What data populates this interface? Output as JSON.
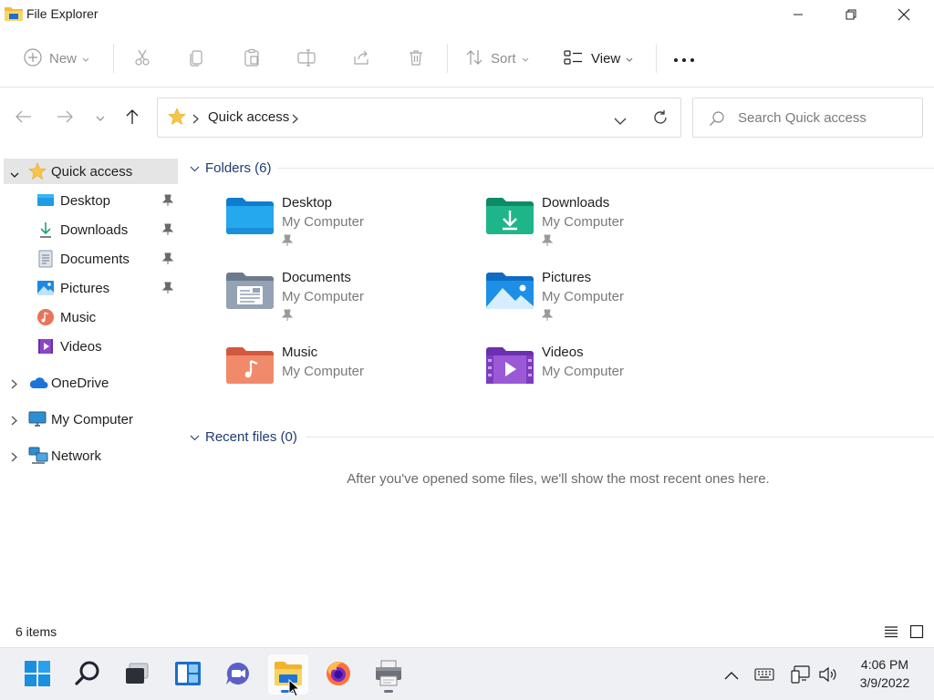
{
  "window": {
    "title": "File Explorer"
  },
  "toolbar": {
    "new_label": "New",
    "sort_label": "Sort",
    "view_label": "View"
  },
  "address": {
    "crumb": "Quick access"
  },
  "search": {
    "placeholder": "Search Quick access"
  },
  "sidebar": {
    "quick_access": "Quick access",
    "items": [
      {
        "label": "Desktop",
        "pinned": true
      },
      {
        "label": "Downloads",
        "pinned": true
      },
      {
        "label": "Documents",
        "pinned": true
      },
      {
        "label": "Pictures",
        "pinned": true
      },
      {
        "label": "Music",
        "pinned": false
      },
      {
        "label": "Videos",
        "pinned": false
      }
    ],
    "onedrive": "OneDrive",
    "my_computer": "My Computer",
    "network": "Network"
  },
  "main": {
    "folders_header": "Folders (6)",
    "folders": [
      {
        "name": "Desktop",
        "location": "My Computer"
      },
      {
        "name": "Downloads",
        "location": "My Computer"
      },
      {
        "name": "Documents",
        "location": "My Computer"
      },
      {
        "name": "Pictures",
        "location": "My Computer"
      },
      {
        "name": "Music",
        "location": "My Computer"
      },
      {
        "name": "Videos",
        "location": "My Computer"
      }
    ],
    "recent_header": "Recent files (0)",
    "recent_empty": "After you've opened some files, we'll show the most recent ones here."
  },
  "status": {
    "item_count": "6 items"
  },
  "taskbar": {
    "time": "4:06 PM",
    "date": "3/9/2022"
  },
  "colors": {
    "accent": "#0078d4",
    "folder_yellow": "#f7c548",
    "section_header": "#1f3b73"
  }
}
